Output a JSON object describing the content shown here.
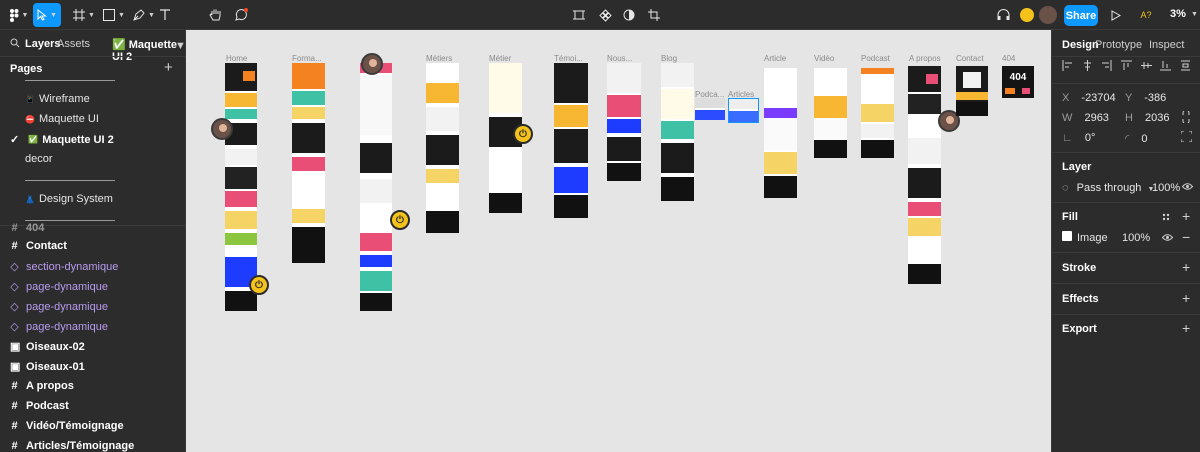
{
  "toolbar": {
    "share_label": "Share",
    "zoom_label": "3%",
    "badge_label": "A?"
  },
  "left_panel": {
    "tab_layers": "Layers",
    "tab_assets": "Assets",
    "page_selector": "✅ Maquette UI 2",
    "pages_title": "Pages",
    "pages": [
      {
        "label": "Wireframe",
        "icon": "📱"
      },
      {
        "label": "Maquette UI",
        "icon": "⛔"
      },
      {
        "label": "Maquette UI 2",
        "icon": "✅",
        "selected": true
      },
      {
        "label": "decor",
        "icon": ""
      },
      {
        "label": "Design System",
        "icon": "👗"
      }
    ],
    "layers": [
      {
        "label": "404",
        "type": "frame"
      },
      {
        "label": "Contact",
        "type": "frame"
      },
      {
        "label": "section-dynamique",
        "type": "component"
      },
      {
        "label": "page-dynamique",
        "type": "component"
      },
      {
        "label": "page-dynamique",
        "type": "component"
      },
      {
        "label": "page-dynamique",
        "type": "component"
      },
      {
        "label": "Oiseaux-02",
        "type": "image"
      },
      {
        "label": "Oiseaux-01",
        "type": "image"
      },
      {
        "label": "A propos",
        "type": "frame"
      },
      {
        "label": "Podcast",
        "type": "frame"
      },
      {
        "label": "Vidéo/Témoignage",
        "type": "frame"
      },
      {
        "label": "Articles/Témoignage",
        "type": "frame"
      }
    ]
  },
  "canvas": {
    "frame_labels": [
      "Home",
      "Forma...",
      "Métiers",
      "Métier",
      "Témoi...",
      "Nous...",
      "Blog",
      "Podca...",
      "Articles",
      "Article",
      "Vidéo",
      "Podcast",
      "A propos",
      "Contact",
      "404"
    ],
    "tile_text": "404"
  },
  "right_panel": {
    "tab_design": "Design",
    "tab_prototype": "Prototype",
    "tab_inspect": "Inspect",
    "x_label": "X",
    "x_value": "-23704",
    "y_label": "Y",
    "y_value": "-386",
    "w_label": "W",
    "w_value": "2963",
    "h_label": "H",
    "h_value": "2036",
    "rotation_value": "0°",
    "radius_value": "0",
    "layer_title": "Layer",
    "blend_mode": "Pass through",
    "layer_opacity": "100%",
    "fill_title": "Fill",
    "fill_type": "Image",
    "fill_opacity": "100%",
    "stroke_title": "Stroke",
    "effects_title": "Effects",
    "export_title": "Export"
  }
}
